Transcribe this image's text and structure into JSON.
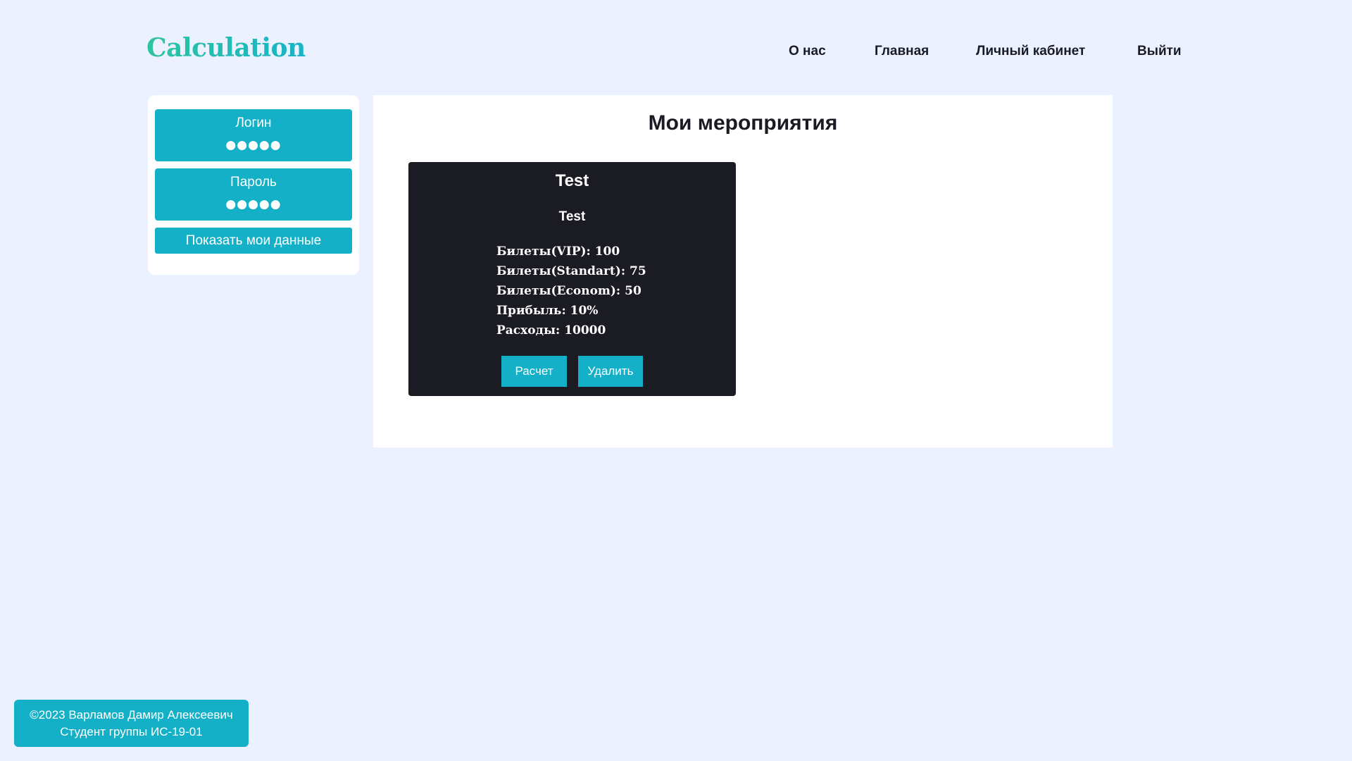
{
  "header": {
    "logo": "Calculation",
    "nav": [
      {
        "label": "О нас"
      },
      {
        "label": "Главная"
      },
      {
        "label": "Личный кабинет"
      },
      {
        "label": "Выйти"
      }
    ]
  },
  "sidebar": {
    "login": {
      "label": "Логин",
      "value": "●●●●●"
    },
    "password": {
      "label": "Пароль",
      "value": "●●●●●"
    },
    "show_button": "Показать мои данные"
  },
  "main": {
    "title": "Мои мероприятия",
    "events": [
      {
        "name": "Test",
        "description": "Test",
        "stats": [
          "Билеты(VIP): 100",
          "Билеты(Standart): 75",
          "Билеты(Econom): 50",
          "Прибыль: 10%",
          "Расходы: 10000"
        ],
        "calc_button": "Расчет",
        "delete_button": "Удалить"
      }
    ]
  },
  "footer": {
    "line1": "©2023 Варламов Дамир Алексеевич",
    "line2": "Студент группы ИС-19-01"
  },
  "colors": {
    "background": "#ebf1ff",
    "accent": "#14b0c8",
    "card": "#1b1b24",
    "logo_gradient_start": "#2ec4a0",
    "logo_gradient_end": "#18b3c8"
  }
}
